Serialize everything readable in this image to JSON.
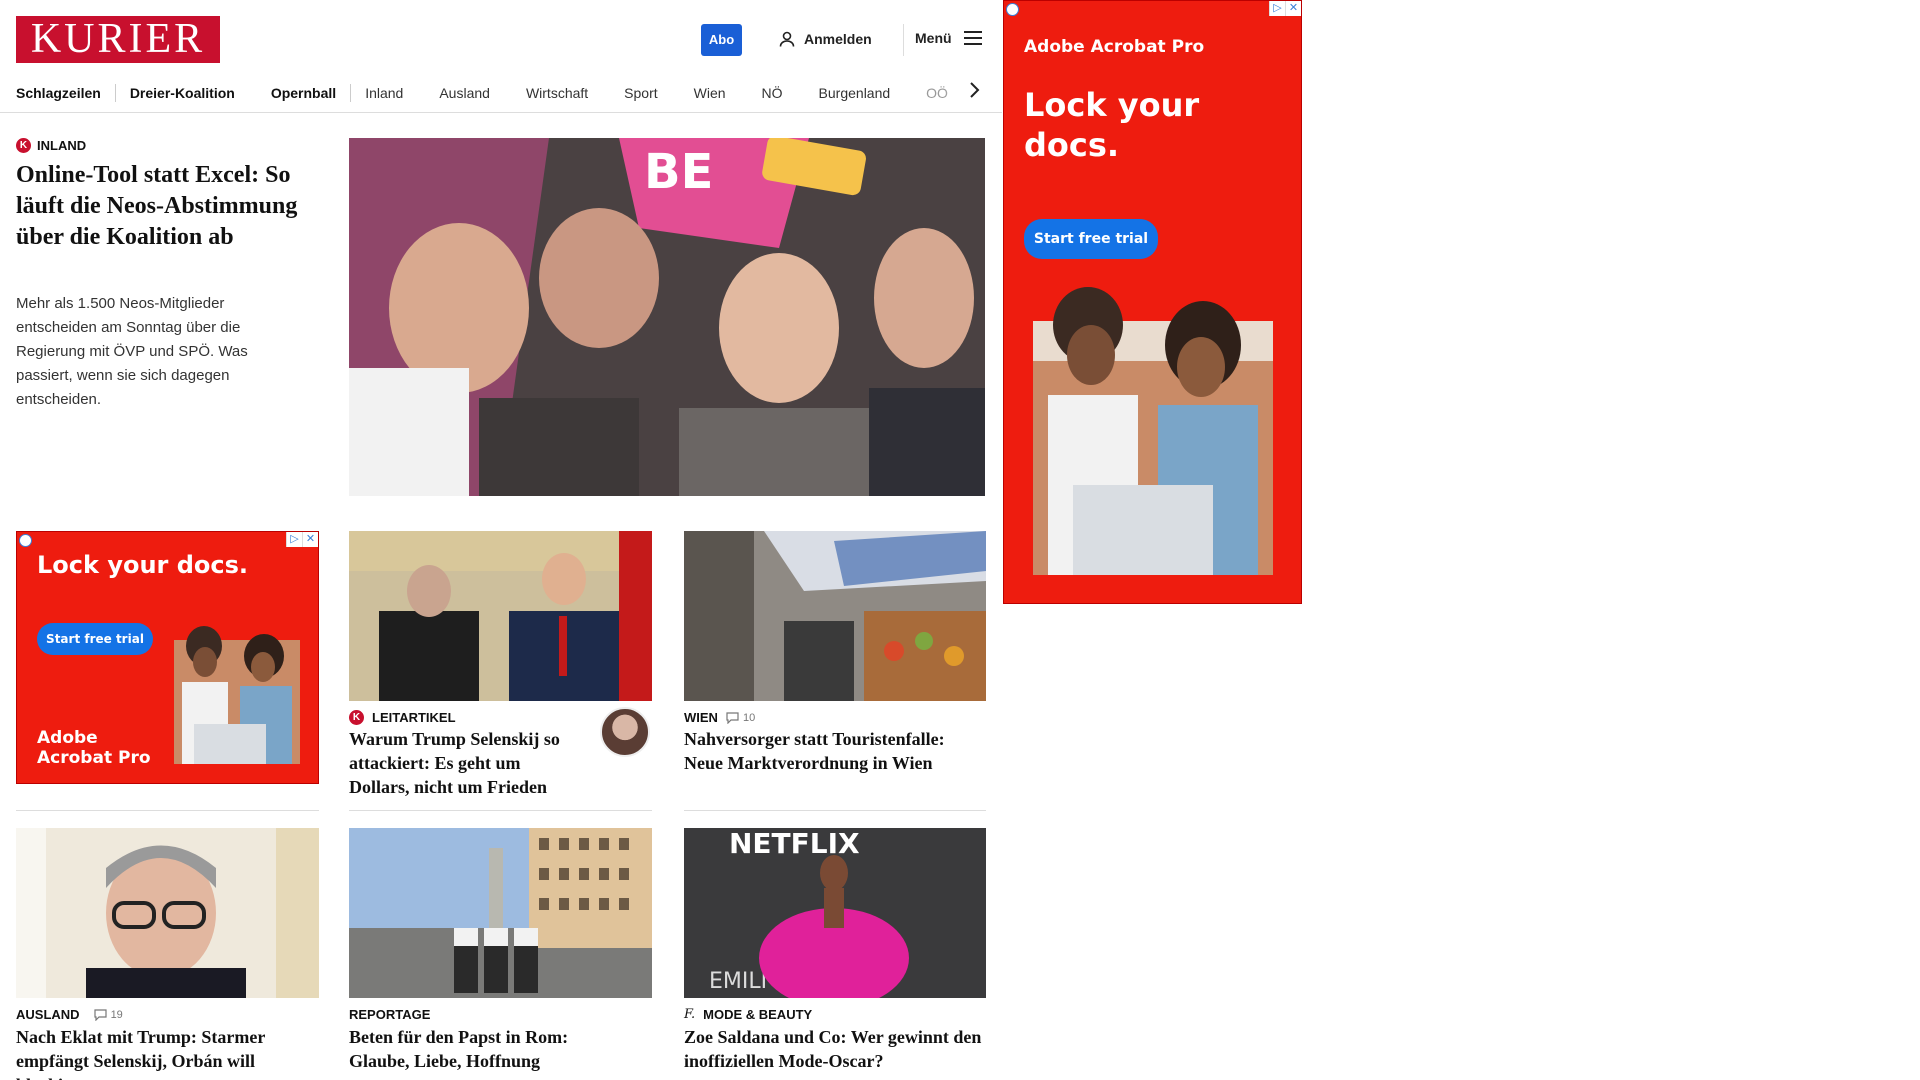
{
  "header": {
    "logo": "KURIER",
    "abo_label": "Abo",
    "login_label": "Anmelden",
    "menu_label": "Menü"
  },
  "nav": {
    "items": [
      "Schlagzeilen",
      "Dreier-Koalition",
      "Opernball",
      "Inland",
      "Ausland",
      "Wirtschaft",
      "Sport",
      "Wien",
      "NÖ",
      "Burgenland",
      "OÖ"
    ]
  },
  "top_story": {
    "kicker": "INLAND",
    "title": "Online-Tool statt Excel: So läuft die Neos-Abstimmung über die Koalition ab",
    "lead": "Mehr als 1.500 Neos-Mitglieder entscheiden am Sonntag über die Regierung mit ÖVP und SPÖ. Was passiert, wenn sie sich dagegen entscheiden."
  },
  "ads": {
    "right": {
      "brand": "Adobe Acrobat Pro",
      "headline": "Lock your docs.",
      "cta": "Start free trial"
    },
    "inline": {
      "brand_line1": "Adobe",
      "brand_line2": "Acrobat Pro",
      "headline": "Lock your docs.",
      "cta": "Start free trial"
    }
  },
  "cards": [
    {
      "kicker": "LEITARTIKEL",
      "title": "Warum Trump Selenskij so attackiert: Es geht um Dollars, nicht um Frieden"
    },
    {
      "kicker": "WIEN",
      "comments": "10",
      "title": "Nahversorger statt Touristenfalle: Neue Marktverordnung in Wien"
    },
    {
      "kicker": "AUSLAND",
      "comments": "19",
      "title": "Nach Eklat mit Trump: Starmer empfängt Selenskij, Orbán will blockieren"
    },
    {
      "kicker": "REPORTAGE",
      "title": "Beten für den Papst in Rom: Glaube, Liebe, Hoffnung"
    },
    {
      "kicker": "MODE & BEAUTY",
      "title": "Zoe Saldana und Co: Wer gewinnt den inoffiziellen Mode-Oscar?"
    }
  ],
  "image_text": {
    "netflix": "NETFLIX",
    "emili": "EMILI",
    "hero_sign": "BE"
  }
}
